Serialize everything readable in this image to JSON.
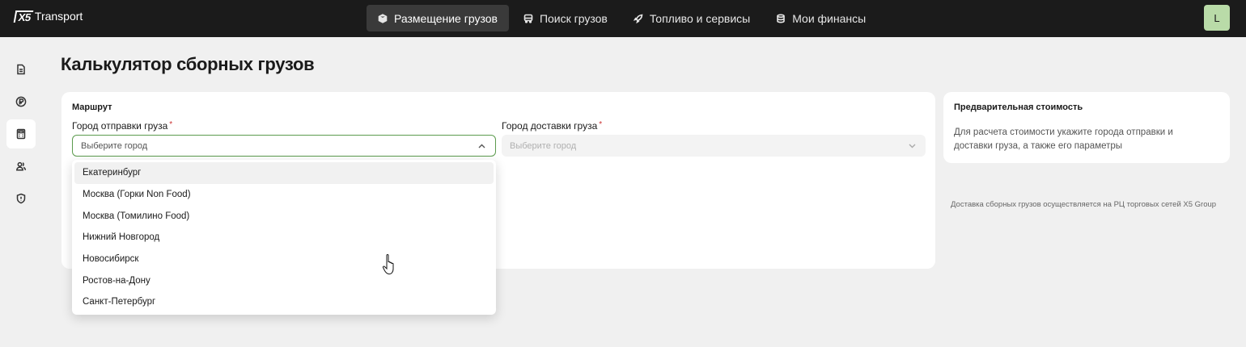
{
  "brand": {
    "mark": "X5",
    "name": "Transport"
  },
  "nav": [
    {
      "label": "Размещение грузов",
      "icon": "box-icon",
      "active": true
    },
    {
      "label": "Поиск грузов",
      "icon": "truck-icon",
      "active": false
    },
    {
      "label": "Топливо и сервисы",
      "icon": "rocket-icon",
      "active": false
    },
    {
      "label": "Мои финансы",
      "icon": "database-icon",
      "active": false
    }
  ],
  "user": {
    "initial": "L",
    "avatar_color": "#b9dba8"
  },
  "sidebar": [
    {
      "icon": "document-icon",
      "active": false
    },
    {
      "icon": "ruble-icon",
      "active": false
    },
    {
      "icon": "calculator-icon",
      "active": true
    },
    {
      "icon": "users-icon",
      "active": false
    },
    {
      "icon": "shield-icon",
      "active": false
    }
  ],
  "page": {
    "title": "Калькулятор сборных грузов"
  },
  "route": {
    "section_label": "Маршрут",
    "from": {
      "label": "Город отправки груза",
      "required_mark": "*",
      "placeholder": "Выберите город"
    },
    "to": {
      "label": "Город доставки груза",
      "required_mark": "*",
      "placeholder": "Выберите город"
    },
    "options": [
      "Екатеринбург",
      "Москва (Горки Non Food)",
      "Москва (Томилино Food)",
      "Нижний Новгород",
      "Новосибирск",
      "Ростов-на-Дону",
      "Санкт-Петербург"
    ]
  },
  "price": {
    "title": "Предварительная стоимость",
    "text": "Для расчета стоимости укажите города отправки и доставки груза, а также его параметры"
  },
  "note": "Доставка сборных грузов осуществляется на РЦ торговых сетей X5 Group",
  "colors": {
    "accent": "#5c9b4e",
    "topbar": "#1b1b1b",
    "background": "#f0f0f0"
  }
}
